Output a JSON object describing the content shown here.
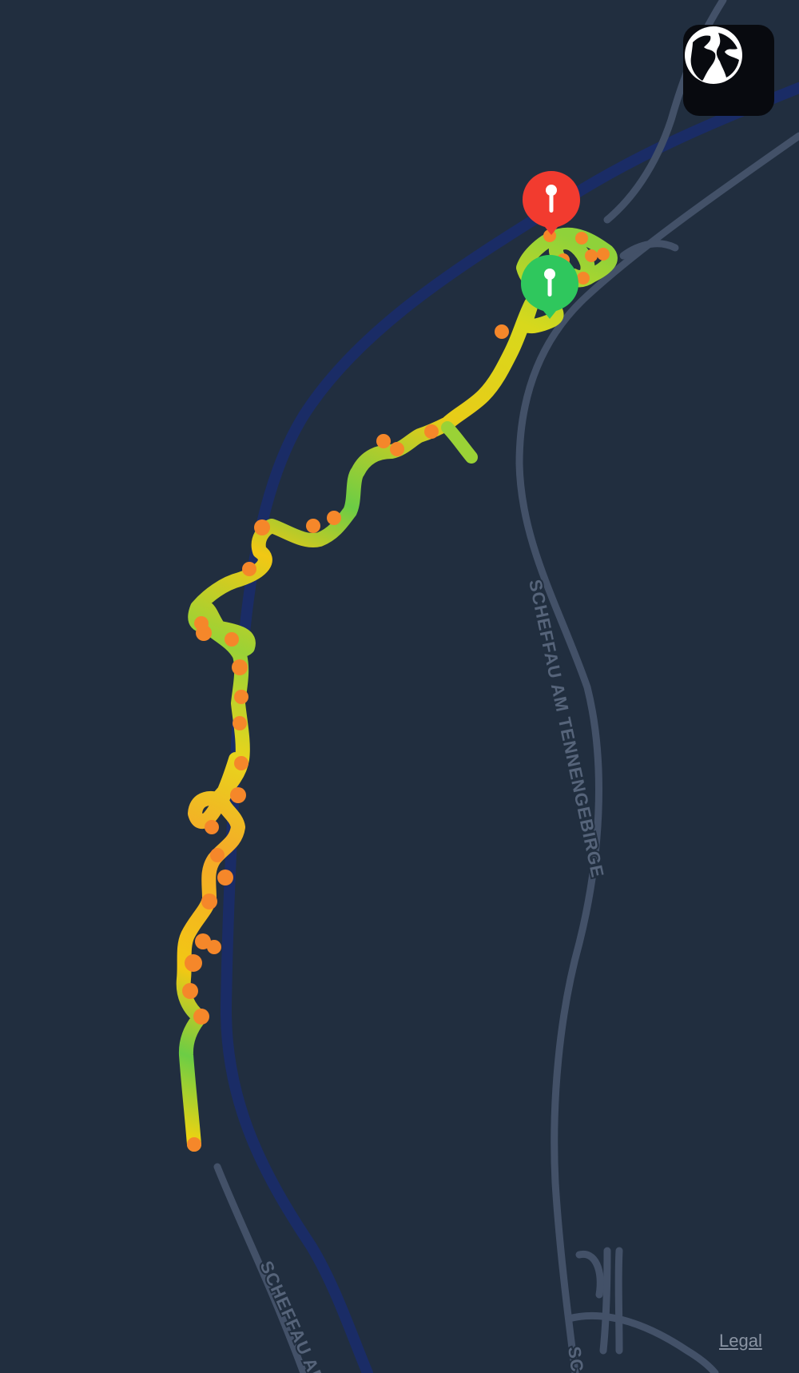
{
  "map": {
    "theme": "dark",
    "colors": {
      "background": "#212e3f",
      "road": "#435168",
      "river": "#1a2c66",
      "track_low": "#4cd964",
      "track_mid": "#f2d310",
      "track_high": "#f5872a",
      "start_marker": "#2fc75d",
      "end_marker": "#f23b2f"
    },
    "road_labels": [
      "SCHEFFAU AM TENNENGEBIRGE",
      "SCHEFFAU AM",
      "SC"
    ]
  },
  "controls": {
    "map_type_button": {
      "icon": "globe-icon"
    },
    "legal_label": "Legal"
  },
  "markers": {
    "start": {
      "icon": "pin-icon",
      "color": "green"
    },
    "end": {
      "icon": "pin-icon",
      "color": "red"
    }
  }
}
